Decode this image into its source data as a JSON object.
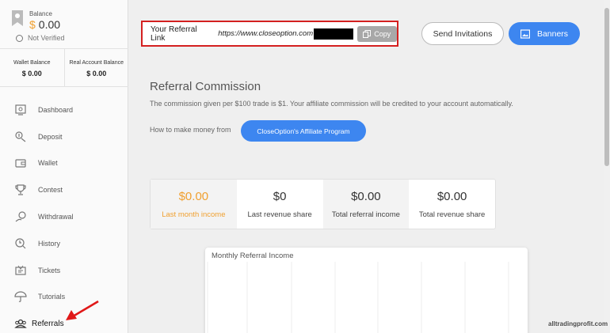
{
  "sidebar": {
    "balance_label": "Balance",
    "balance_currency": "$",
    "balance_amount": "0.00",
    "verification": "Not Verified",
    "wallet_balance_label": "Wallet Balance",
    "wallet_balance_value": "$ 0.00",
    "real_balance_label": "Real Account Balance",
    "real_balance_value": "$ 0.00",
    "nav": [
      {
        "label": "Dashboard",
        "icon": "dashboard-icon"
      },
      {
        "label": "Deposit",
        "icon": "deposit-icon"
      },
      {
        "label": "Wallet",
        "icon": "wallet-icon"
      },
      {
        "label": "Contest",
        "icon": "trophy-icon"
      },
      {
        "label": "Withdrawal",
        "icon": "withdrawal-icon"
      },
      {
        "label": "History",
        "icon": "history-icon"
      },
      {
        "label": "Tickets",
        "icon": "tickets-icon"
      },
      {
        "label": "Tutorials",
        "icon": "umbrella-icon"
      },
      {
        "label": "Referrals",
        "icon": "referrals-icon"
      }
    ]
  },
  "referral": {
    "label": "Your Referral Link",
    "url": "https://www.closeoption.com",
    "copy_label": "Copy"
  },
  "header": {
    "send_label": "Send Invitations",
    "banners_label": "Banners"
  },
  "commission": {
    "title": "Referral Commission",
    "description": "The commission given per $100 trade is $1. Your affiliate commission will be credited to your account automatically.",
    "how_text": "How to make money from",
    "affiliate_button": "CloseOption's Affiliate Program"
  },
  "stats": [
    {
      "value": "$0.00",
      "label": "Last month income"
    },
    {
      "value": "$0",
      "label": "Last revenue share"
    },
    {
      "value": "$0.00",
      "label": "Total referral income"
    },
    {
      "value": "$0.00",
      "label": "Total revenue share"
    }
  ],
  "chart": {
    "title": "Monthly Referral Income"
  },
  "watermark": "alltradingprofit.com",
  "colors": {
    "accent": "#3d86f0",
    "orange": "#f0a030",
    "highlight_red": "#d42020"
  }
}
